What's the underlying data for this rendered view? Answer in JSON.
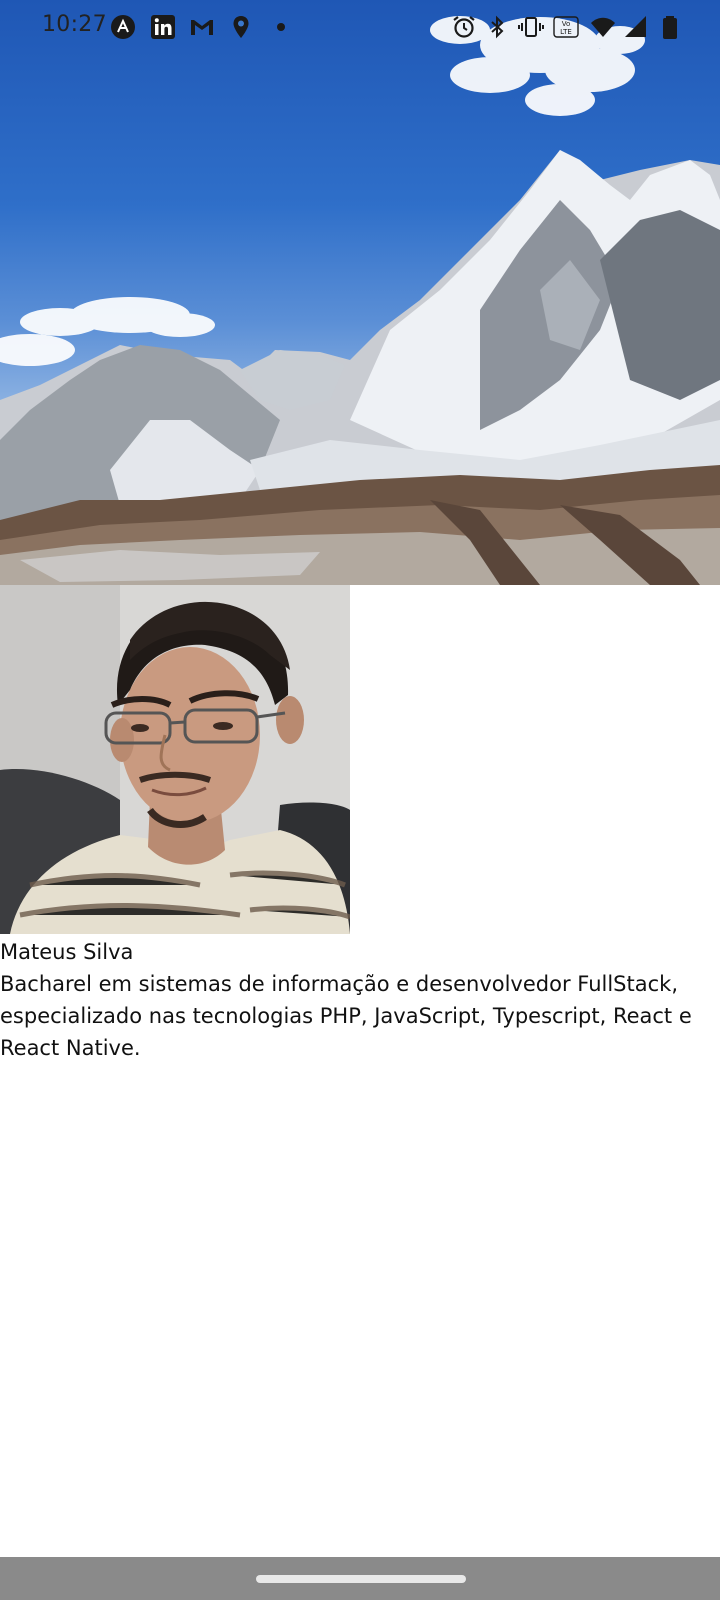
{
  "status_bar": {
    "time": "10:27",
    "left_icons": [
      "app-a-icon",
      "linkedin-icon",
      "gmail-icon",
      "location-icon",
      "dot-icon"
    ],
    "right_icons": [
      "alarm-icon",
      "bluetooth-icon",
      "vibrate-icon",
      "volte-icon",
      "wifi-icon",
      "signal-icon",
      "battery-icon"
    ]
  },
  "profile": {
    "name": "Mateus Silva",
    "bio": "Bacharel em sistemas de informação e desenvolvedor FullStack, especializado nas tecnologias PHP, JavaScript, Typescript, React e React Native."
  },
  "colors": {
    "sky": "#2f6fc9",
    "nav_bar": "#8a8a8a",
    "text": "#111111"
  }
}
